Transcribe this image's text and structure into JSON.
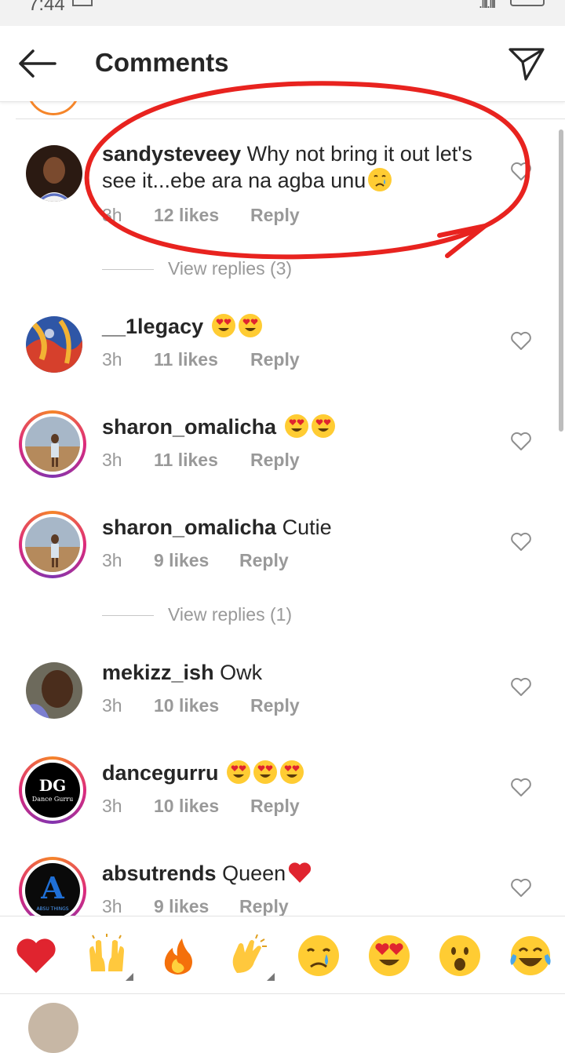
{
  "status_bar": {
    "time": "7:44"
  },
  "header": {
    "title": "Comments"
  },
  "accent_colors": {
    "story_ring_start": "#f58529",
    "story_ring_mid": "#dd2a7b",
    "story_ring_end": "#8134af",
    "annotation_red": "#e8231f",
    "heart_red": "#e0242f"
  },
  "comments": [
    {
      "username": "sandysteveey",
      "text": "Why not bring it out let's see it...ebe ara na agba unu",
      "emoji": "crying-face",
      "time": "3h",
      "likes": "12 likes",
      "reply": "Reply"
    },
    {
      "username": "__1legacy",
      "text": "",
      "emoji": "heart-eyes x2",
      "time": "3h",
      "likes": "11 likes",
      "reply": "Reply"
    },
    {
      "username": "sharon_omalicha",
      "text": "",
      "emoji": "heart-eyes x2",
      "time": "3h",
      "likes": "11 likes",
      "reply": "Reply"
    },
    {
      "username": "sharon_omalicha",
      "text": "Cutie",
      "time": "3h",
      "likes": "9 likes",
      "reply": "Reply"
    },
    {
      "username": "mekizz_ish",
      "text": "Owk",
      "time": "3h",
      "likes": "10 likes",
      "reply": "Reply"
    },
    {
      "username": "dancegurru",
      "text": "",
      "emoji": "heart-eyes x3",
      "time": "3h",
      "likes": "10 likes",
      "reply": "Reply"
    },
    {
      "username": "absutrends",
      "text": "Queen",
      "emoji": "red-heart",
      "time": "3h",
      "likes": "9 likes",
      "reply": "Reply"
    }
  ],
  "view_replies": [
    "View replies (3)",
    "View replies (1)"
  ],
  "avatar_text": {
    "dancegurru_logo": "DG",
    "dancegurru_sub": "Dance Gurru",
    "absutrends_logo": "A",
    "absutrends_sub": "ABSU THINGS"
  },
  "emoji_bar": [
    "red-heart",
    "raising-hands",
    "fire",
    "clapping-hands",
    "crying-face",
    "heart-eyes",
    "surprised-face",
    "tears-of-joy"
  ]
}
